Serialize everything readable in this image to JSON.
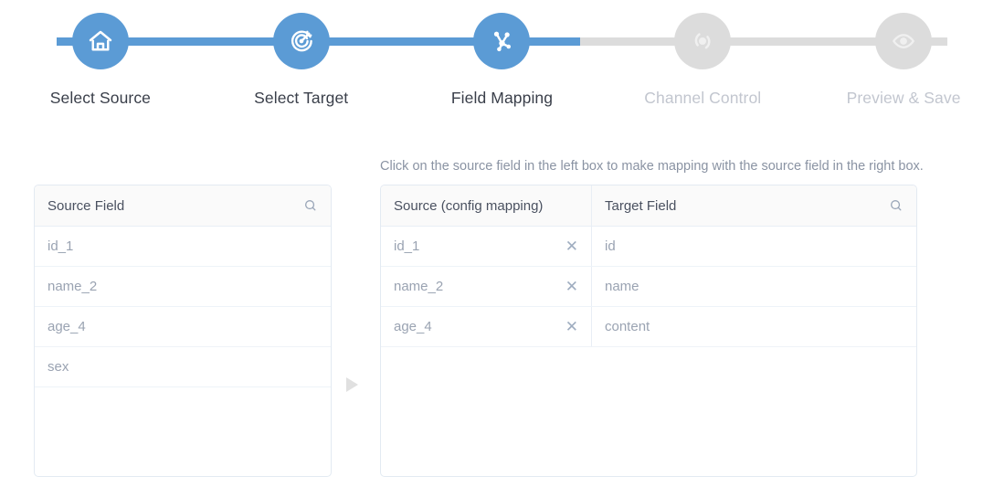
{
  "stepper": {
    "steps": [
      {
        "label": "Select Source",
        "icon": "home-icon",
        "state": "active"
      },
      {
        "label": "Select Target",
        "icon": "target-icon",
        "state": "active"
      },
      {
        "label": "Field Mapping",
        "icon": "node-graph-icon",
        "state": "active"
      },
      {
        "label": "Channel Control",
        "icon": "dial-icon",
        "state": "inactive"
      },
      {
        "label": "Preview & Save",
        "icon": "eye-icon",
        "state": "inactive"
      }
    ],
    "active_color": "#5b9bd5",
    "inactive_color": "#dcdcdc"
  },
  "hint": {
    "text": "Click on the source field in the left box to make mapping with the source field in the right box."
  },
  "source_panel": {
    "header": {
      "title": "Source Field",
      "search_icon": "search-icon"
    },
    "rows": [
      {
        "field": "id_1"
      },
      {
        "field": "name_2"
      },
      {
        "field": "age_4"
      },
      {
        "field": "sex"
      }
    ]
  },
  "mapping_panel": {
    "header": {
      "source_title": "Source (config mapping)",
      "target_title": "Target Field",
      "search_icon": "search-icon"
    },
    "rows": [
      {
        "source": "id_1",
        "target": "id",
        "remove_icon": "close-icon"
      },
      {
        "source": "name_2",
        "target": "name",
        "remove_icon": "close-icon"
      },
      {
        "source": "age_4",
        "target": "content",
        "remove_icon": "close-icon"
      }
    ]
  },
  "arrow": {
    "icon": "arrow-right-icon"
  }
}
